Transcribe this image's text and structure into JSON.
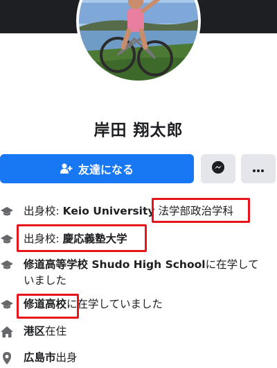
{
  "profile": {
    "name": "岸田 翔太郎"
  },
  "actions": {
    "add_friend_label": "友達になる"
  },
  "about": [
    {
      "icon": "graduation-cap-icon",
      "prefix": "出身校: ",
      "bold": "Keio University",
      "suffix": " 法学部政治学科"
    },
    {
      "icon": "graduation-cap-icon",
      "prefix": "出身校: ",
      "bold": "慶応義塾大学",
      "suffix": ""
    },
    {
      "icon": "graduation-cap-icon",
      "prefix": "",
      "bold": "修道高等学校 Shudo High School",
      "suffix": "に在学していました"
    },
    {
      "icon": "graduation-cap-icon",
      "prefix": "",
      "bold": "修道高校",
      "suffix": "に在学していました"
    },
    {
      "icon": "home-icon",
      "prefix": "",
      "bold": "港区",
      "suffix": "在住"
    },
    {
      "icon": "location-pin-icon",
      "prefix": "",
      "bold": "広島市",
      "suffix": "出身"
    }
  ],
  "colors": {
    "accent": "#1877f2",
    "highlight": "#e8141c",
    "cover": "#1d1f22"
  }
}
